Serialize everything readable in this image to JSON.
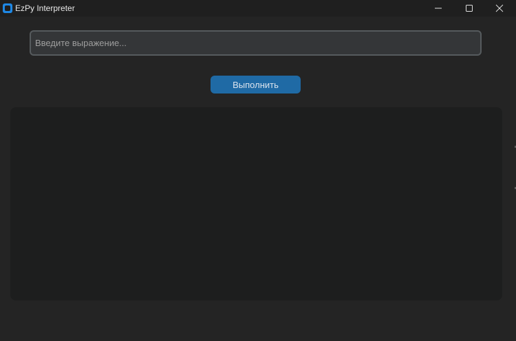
{
  "window": {
    "title": "EzPy Interpreter",
    "icon": "app-icon"
  },
  "controls": {
    "minimize_icon": "minimize-icon",
    "maximize_icon": "maximize-icon",
    "close_icon": "close-icon"
  },
  "input": {
    "value": "",
    "placeholder": "Введите выражение..."
  },
  "run_button": {
    "label": "Выполнить"
  },
  "output": {
    "text": ""
  },
  "colors": {
    "background": "#242424",
    "titlebar": "#1f1f1f",
    "input_bg": "#343638",
    "input_border": "#565b5e",
    "accent": "#1f6aa5",
    "output_bg": "#1d1e1e"
  }
}
